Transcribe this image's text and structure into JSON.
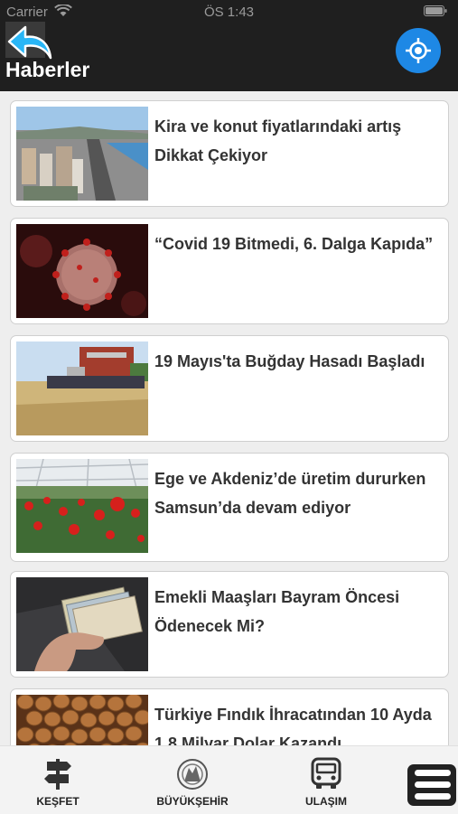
{
  "status_bar": {
    "carrier": "Carrier",
    "time": "ÖS 1:43"
  },
  "header": {
    "title": "Haberler",
    "back_icon": "back-arrow-icon",
    "location_icon": "location-target-icon",
    "accent": "#1e88e5"
  },
  "news": [
    {
      "title": "Kira ve konut fiyatlarındaki artış Dikkat Çekiyor",
      "image": "coastal city aerial"
    },
    {
      "title": "“Covid 19 Bitmedi, 6. Dalga Kapıda”",
      "image": "virus"
    },
    {
      "title": "19 Mayıs'ta Buğday Hasadı Başladı",
      "image": "wheat harvest"
    },
    {
      "title": "Ege ve Akdeniz’de üretim dururken Samsun’da devam ediyor",
      "image": "greenhouse flowers"
    },
    {
      "title": "Emekli Maaşları Bayram Öncesi Ödenecek Mi?",
      "image": "banknotes in hand"
    },
    {
      "title": "Türkiye Fındık İhracatından 10 Ayda 1,8 Milyar Dolar Kazandı",
      "image": "hazelnuts"
    }
  ],
  "tabs": [
    {
      "label": "KEŞFET",
      "icon": "signpost-icon"
    },
    {
      "label": "BÜYÜKŞEHİR",
      "icon": "municipality-emblem-icon"
    },
    {
      "label": "ULAŞIM",
      "icon": "bus-icon"
    }
  ],
  "menu": {
    "icon": "hamburger-menu-icon"
  }
}
